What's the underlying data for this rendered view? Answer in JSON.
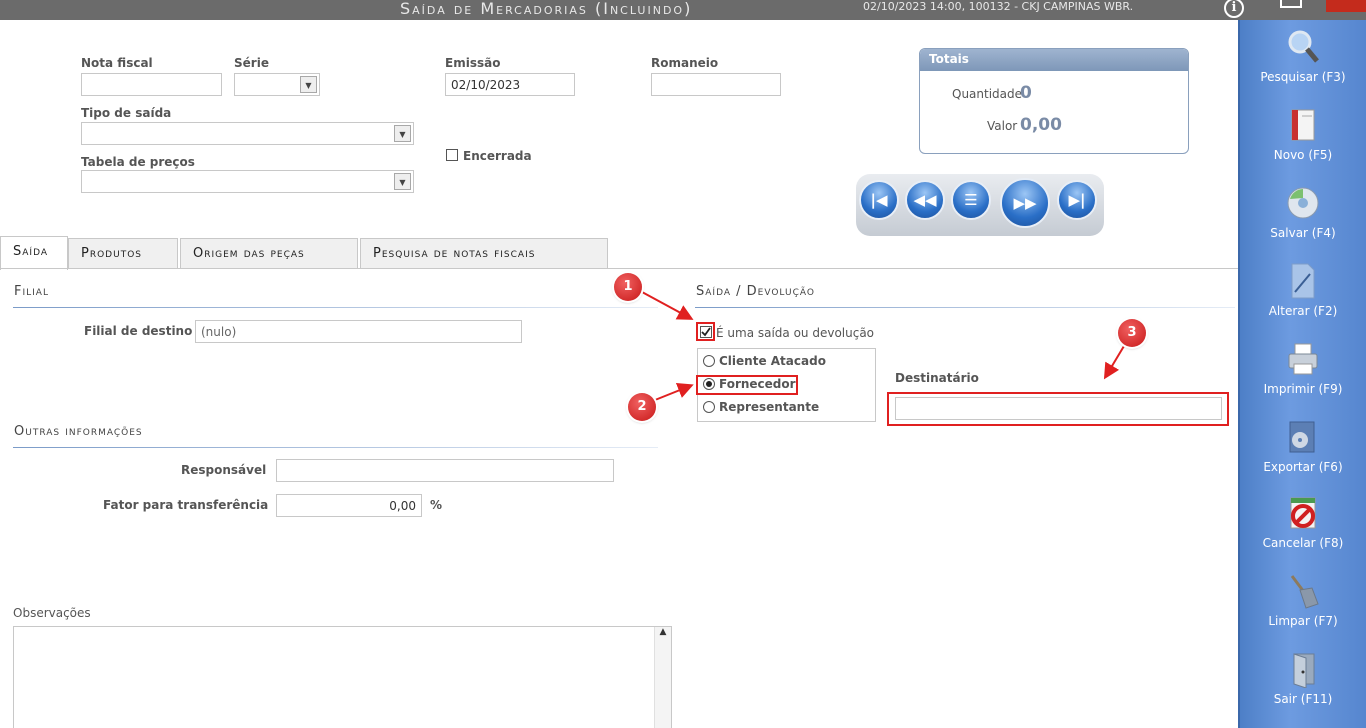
{
  "window": {
    "title": "Saída de Mercadorias (Incluindo)",
    "status": "02/10/2023 14:00, 100132 - CKJ CAMPINAS WBR."
  },
  "header": {
    "nota_fiscal_label": "Nota fiscal",
    "nota_fiscal_value": "",
    "serie_label": "Série",
    "emissao_label": "Emissão",
    "emissao_value": "02/10/2023",
    "romaneio_label": "Romaneio",
    "romaneio_value": "",
    "tipo_saida_label": "Tipo de saída",
    "tabela_precos_label": "Tabela de preços",
    "encerrada_label": "Encerrada"
  },
  "totais": {
    "title": "Totais",
    "quantidade_label": "Quantidade",
    "quantidade_value": "0",
    "valor_label": "Valor",
    "valor_value": "0,00"
  },
  "tabs": [
    {
      "label": "Saída",
      "active": true
    },
    {
      "label": "Produtos",
      "active": false
    },
    {
      "label": "Origem das peças",
      "active": false
    },
    {
      "label": "Pesquisa de notas fiscais",
      "active": false
    }
  ],
  "filial": {
    "section": "Filial",
    "destino_label": "Filial de destino",
    "destino_value": "(nulo)"
  },
  "outras": {
    "section": "Outras informações",
    "responsavel_label": "Responsável",
    "responsavel_value": "",
    "fator_label": "Fator para transferência",
    "fator_value": "0,00",
    "fator_unit": "%"
  },
  "observacoes": {
    "label": "Observações"
  },
  "saida_devolucao": {
    "section": "Saída / Devolução",
    "checkbox_label": "É uma saída ou devolução",
    "checked": true,
    "options": [
      "Cliente Atacado",
      "Fornecedor",
      "Representante"
    ],
    "selected": "Fornecedor",
    "destinatario_label": "Destinatário",
    "destinatario_value": ""
  },
  "callouts": [
    "1",
    "2",
    "3"
  ],
  "sidebar": [
    {
      "label": "Pesquisar (F3)",
      "icon": "magnifier-icon"
    },
    {
      "label": "Novo (F5)",
      "icon": "new-book-icon"
    },
    {
      "label": "Salvar (F4)",
      "icon": "disc-icon"
    },
    {
      "label": "Alterar (F2)",
      "icon": "edit-document-icon"
    },
    {
      "label": "Imprimir (F9)",
      "icon": "printer-icon"
    },
    {
      "label": "Exportar (F6)",
      "icon": "export-icon"
    },
    {
      "label": "Cancelar (F8)",
      "icon": "cancel-icon"
    },
    {
      "label": "Limpar (F7)",
      "icon": "broom-icon"
    },
    {
      "label": "Sair (F11)",
      "icon": "exit-door-icon"
    }
  ]
}
